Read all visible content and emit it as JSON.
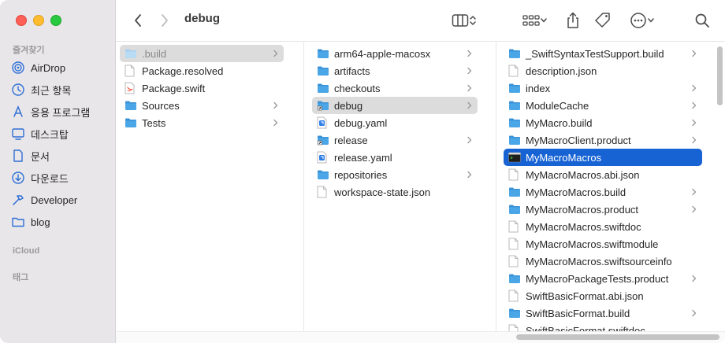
{
  "window": {
    "title": "debug"
  },
  "sidebar": {
    "favorites_header": "즐겨찾기",
    "items": [
      {
        "label": "AirDrop",
        "icon": "airdrop-icon"
      },
      {
        "label": "최근 항목",
        "icon": "clock-icon"
      },
      {
        "label": "응용 프로그램",
        "icon": "applications-icon"
      },
      {
        "label": "데스크탑",
        "icon": "desktop-icon"
      },
      {
        "label": "문서",
        "icon": "document-icon"
      },
      {
        "label": "다운로드",
        "icon": "download-icon"
      },
      {
        "label": "Developer",
        "icon": "hammer-icon"
      },
      {
        "label": "blog",
        "icon": "folder-icon"
      }
    ],
    "icloud_header": "iCloud",
    "tags_header": "태그"
  },
  "columns": [
    {
      "items": [
        {
          "label": ".build",
          "type": "folder-light",
          "chevron": true,
          "state": "selected-inactive"
        },
        {
          "label": "Package.resolved",
          "type": "file",
          "chevron": false
        },
        {
          "label": "Package.swift",
          "type": "swift-file",
          "chevron": false
        },
        {
          "label": "Sources",
          "type": "folder",
          "chevron": true
        },
        {
          "label": "Tests",
          "type": "folder",
          "chevron": true
        }
      ]
    },
    {
      "items": [
        {
          "label": "arm64-apple-macosx",
          "type": "folder",
          "chevron": true
        },
        {
          "label": "artifacts",
          "type": "folder",
          "chevron": true
        },
        {
          "label": "checkouts",
          "type": "folder",
          "chevron": true
        },
        {
          "label": "debug",
          "type": "alias-folder",
          "chevron": true,
          "state": "selected-inactive"
        },
        {
          "label": "debug.yaml",
          "type": "yaml-file",
          "chevron": false
        },
        {
          "label": "release",
          "type": "alias-folder",
          "chevron": true
        },
        {
          "label": "release.yaml",
          "type": "yaml-file",
          "chevron": false
        },
        {
          "label": "repositories",
          "type": "folder",
          "chevron": true
        },
        {
          "label": "workspace-state.json",
          "type": "file",
          "chevron": false
        }
      ]
    },
    {
      "items": [
        {
          "label": "_SwiftSyntaxTestSupport.build",
          "type": "folder",
          "chevron": true
        },
        {
          "label": "description.json",
          "type": "file",
          "chevron": false
        },
        {
          "label": "index",
          "type": "folder",
          "chevron": true
        },
        {
          "label": "ModuleCache",
          "type": "folder",
          "chevron": true
        },
        {
          "label": "MyMacro.build",
          "type": "folder",
          "chevron": true
        },
        {
          "label": "MyMacroClient.product",
          "type": "folder",
          "chevron": true
        },
        {
          "label": "MyMacroMacros",
          "type": "exec",
          "chevron": false,
          "state": "selected-active"
        },
        {
          "label": "MyMacroMacros.abi.json",
          "type": "file",
          "chevron": false
        },
        {
          "label": "MyMacroMacros.build",
          "type": "folder",
          "chevron": true
        },
        {
          "label": "MyMacroMacros.product",
          "type": "folder",
          "chevron": true
        },
        {
          "label": "MyMacroMacros.swiftdoc",
          "type": "file",
          "chevron": false
        },
        {
          "label": "MyMacroMacros.swiftmodule",
          "type": "file",
          "chevron": false
        },
        {
          "label": "MyMacroMacros.swiftsourceinfo",
          "type": "file",
          "chevron": false
        },
        {
          "label": "MyMacroPackageTests.product",
          "type": "folder",
          "chevron": true
        },
        {
          "label": "SwiftBasicFormat.abi.json",
          "type": "file",
          "chevron": false
        },
        {
          "label": "SwiftBasicFormat.build",
          "type": "folder",
          "chevron": true
        },
        {
          "label": "SwiftBasicFormat.swiftdoc",
          "type": "file",
          "chevron": false
        }
      ]
    }
  ],
  "colors": {
    "sidebar_bg": "#e8e6e9",
    "accent": "#1763d4",
    "folder": "#4aa6e6",
    "sidebar_icon": "#2f6fd6"
  }
}
